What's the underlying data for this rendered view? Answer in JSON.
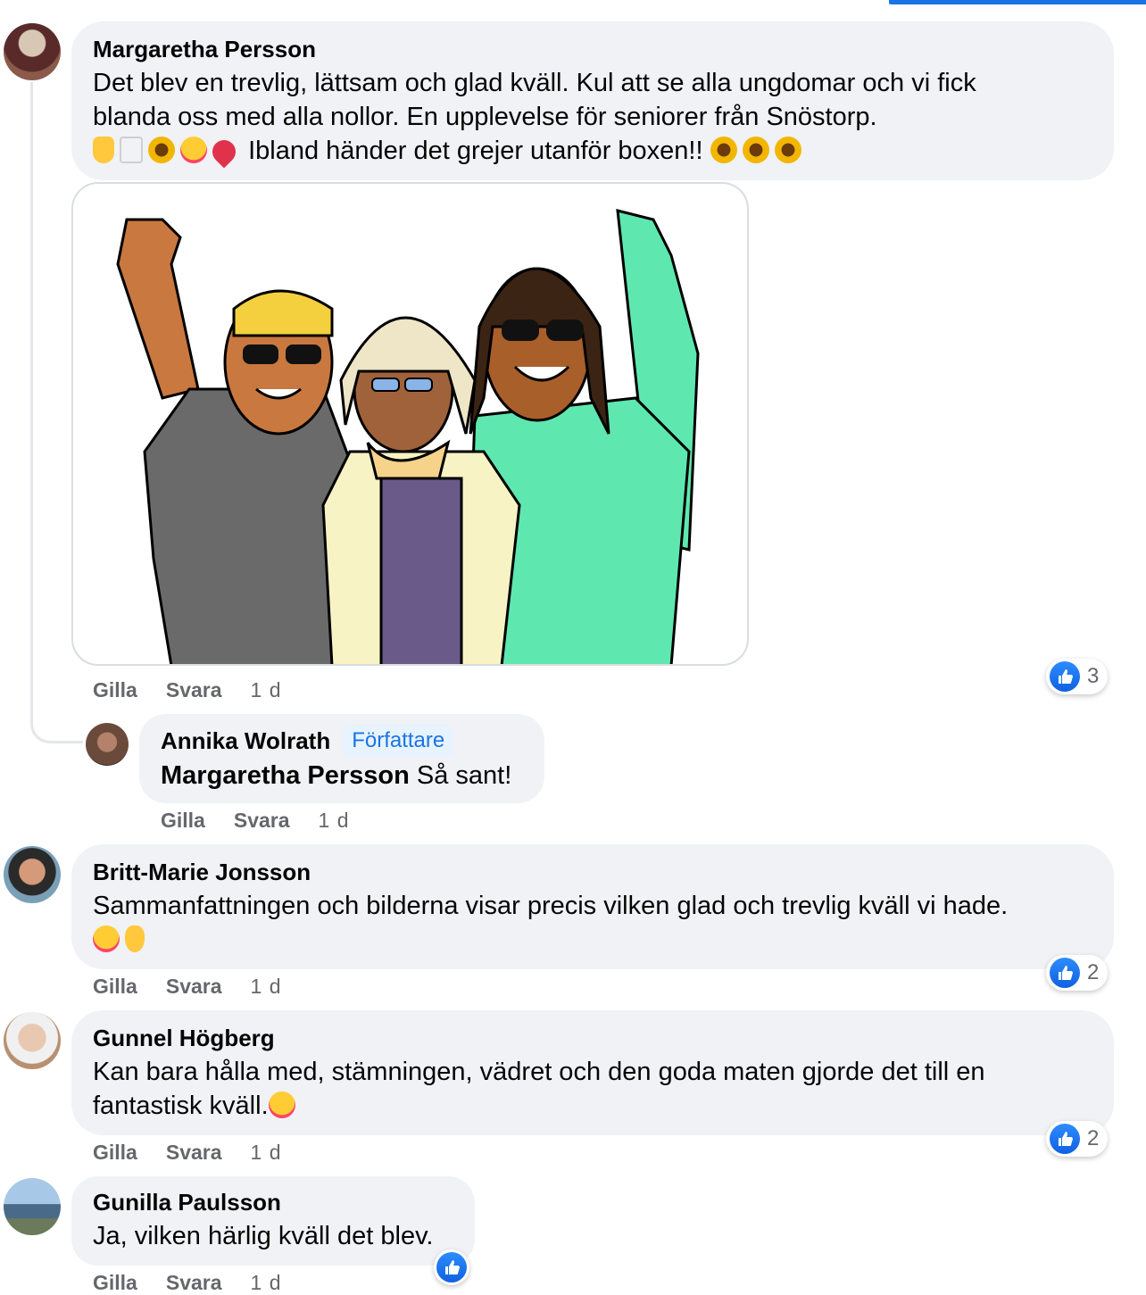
{
  "comments": [
    {
      "author": "Margaretha Persson",
      "text_line1": "Det blev en trevlig, lättsam och glad kväll. Kul att se alla ungdomar och vi fick",
      "text_line2": "blanda oss med alla nollor. En upplevelse för seniorer från Snöstorp.",
      "text_line3": "Ibland händer det grejer utanför boxen!!",
      "actions": {
        "like": "Gilla",
        "reply": "Svara",
        "time": "1 d"
      },
      "reaction_count": "3"
    },
    {
      "author": "Annika Wolrath",
      "badge": "Författare",
      "mention": "Margaretha Persson",
      "text": " Så sant!",
      "actions": {
        "like": "Gilla",
        "reply": "Svara",
        "time": "1 d"
      }
    },
    {
      "author": "Britt-Marie Jonsson",
      "text_line1": "Sammanfattningen och bilderna visar precis vilken glad och trevlig kväll vi hade.",
      "actions": {
        "like": "Gilla",
        "reply": "Svara",
        "time": "1 d"
      },
      "reaction_count": "2"
    },
    {
      "author": "Gunnel Högberg",
      "text_line1": "Kan bara hålla med, stämningen, vädret och den goda maten gjorde det till en",
      "text_line2": "fantastisk kväll.",
      "actions": {
        "like": "Gilla",
        "reply": "Svara",
        "time": "1 d"
      },
      "reaction_count": "2"
    },
    {
      "author": "Gunilla Paulsson",
      "text_line1": "Ja, vilken härlig kväll det blev.",
      "actions": {
        "like": "Gilla",
        "reply": "Svara",
        "time": "1 d"
      }
    }
  ],
  "colors": {
    "accent": "#1b74e4",
    "bubble": "#f0f2f5",
    "muted": "#65676b"
  }
}
